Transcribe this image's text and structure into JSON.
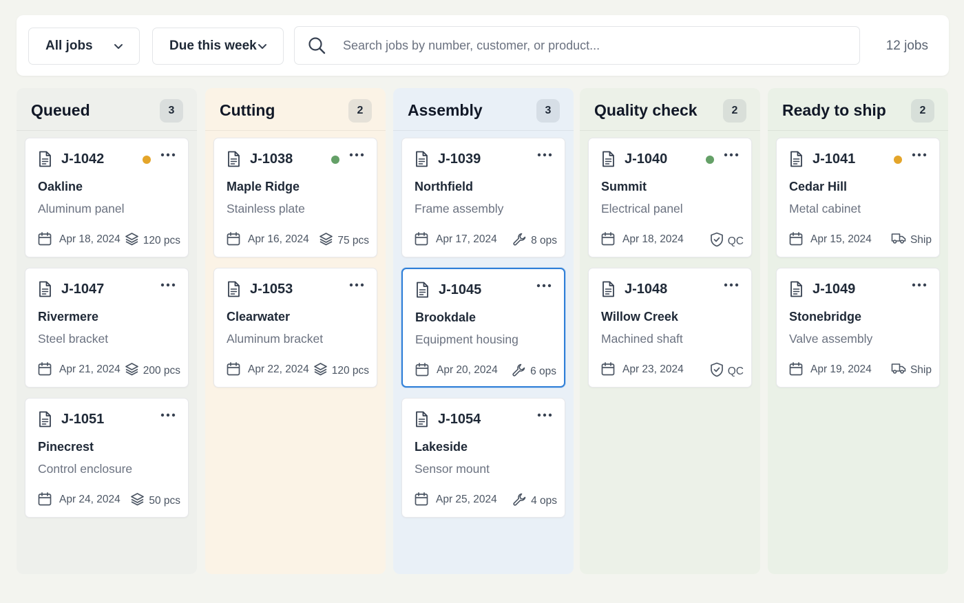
{
  "toolbar": {
    "filter_jobs": "All jobs",
    "filter_due": "Due this week",
    "search_placeholder": "Search jobs by number, customer, or product...",
    "job_count": "12 jobs"
  },
  "colors": {
    "accent": "#2f7fd8",
    "status_yellow": "#e4a52a",
    "status_green": "#64a067",
    "col_queued": "#eef0ec",
    "col_cutting": "#fbf3e6",
    "col_assembly": "#e9f0f7",
    "col_quality": "#ecf1e8",
    "col_ready": "#eaf1e7"
  },
  "columns": [
    {
      "title": "Queued",
      "count": "3",
      "cards": [
        {
          "job": "J-1042",
          "customer": "Oakline",
          "product": "Aluminum panel",
          "date": "Apr 18, 2024",
          "meta": "120 pcs",
          "meta_icon": "layers-icon",
          "status": "yellow"
        },
        {
          "job": "J-1047",
          "customer": "Rivermere",
          "product": "Steel bracket",
          "date": "Apr 21, 2024",
          "meta": "200 pcs",
          "meta_icon": "layers-icon",
          "status": ""
        },
        {
          "job": "J-1051",
          "customer": "Pinecrest",
          "product": "Control enclosure",
          "date": "Apr 24, 2024",
          "meta": "50 pcs",
          "meta_icon": "layers-icon",
          "status": ""
        }
      ]
    },
    {
      "title": "Cutting",
      "count": "2",
      "cards": [
        {
          "job": "J-1038",
          "customer": "Maple Ridge",
          "product": "Stainless plate",
          "date": "Apr 16, 2024",
          "meta": "75 pcs",
          "meta_icon": "layers-icon",
          "status": "green"
        },
        {
          "job": "J-1053",
          "customer": "Clearwater",
          "product": "Aluminum bracket",
          "date": "Apr 22, 2024",
          "meta": "120 pcs",
          "meta_icon": "layers-icon",
          "status": ""
        }
      ]
    },
    {
      "title": "Assembly",
      "count": "3",
      "cards": [
        {
          "job": "J-1039",
          "customer": "Northfield",
          "product": "Frame assembly",
          "date": "Apr 17, 2024",
          "meta": "8 ops",
          "meta_icon": "wrench-icon",
          "status": ""
        },
        {
          "job": "J-1045",
          "customer": "Brookdale",
          "product": "Equipment housing",
          "date": "Apr 20, 2024",
          "meta": "6 ops",
          "meta_icon": "wrench-icon",
          "status": "",
          "selected": true
        },
        {
          "job": "J-1054",
          "customer": "Lakeside",
          "product": "Sensor mount",
          "date": "Apr 25, 2024",
          "meta": "4 ops",
          "meta_icon": "wrench-icon",
          "status": ""
        }
      ]
    },
    {
      "title": "Quality check",
      "count": "2",
      "cards": [
        {
          "job": "J-1040",
          "customer": "Summit",
          "product": "Electrical panel",
          "date": "Apr 18, 2024",
          "meta": "QC",
          "meta_icon": "shield-check-icon",
          "status": "green"
        },
        {
          "job": "J-1048",
          "customer": "Willow Creek",
          "product": "Machined shaft",
          "date": "Apr 23, 2024",
          "meta": "QC",
          "meta_icon": "shield-check-icon",
          "status": ""
        }
      ]
    },
    {
      "title": "Ready to ship",
      "count": "2",
      "cards": [
        {
          "job": "J-1041",
          "customer": "Cedar Hill",
          "product": "Metal cabinet",
          "date": "Apr 15, 2024",
          "meta": "Ship",
          "meta_icon": "truck-icon",
          "status": "yellow"
        },
        {
          "job": "J-1049",
          "customer": "Stonebridge",
          "product": "Valve assembly",
          "date": "Apr 19, 2024",
          "meta": "Ship",
          "meta_icon": "truck-icon",
          "status": ""
        }
      ]
    }
  ]
}
